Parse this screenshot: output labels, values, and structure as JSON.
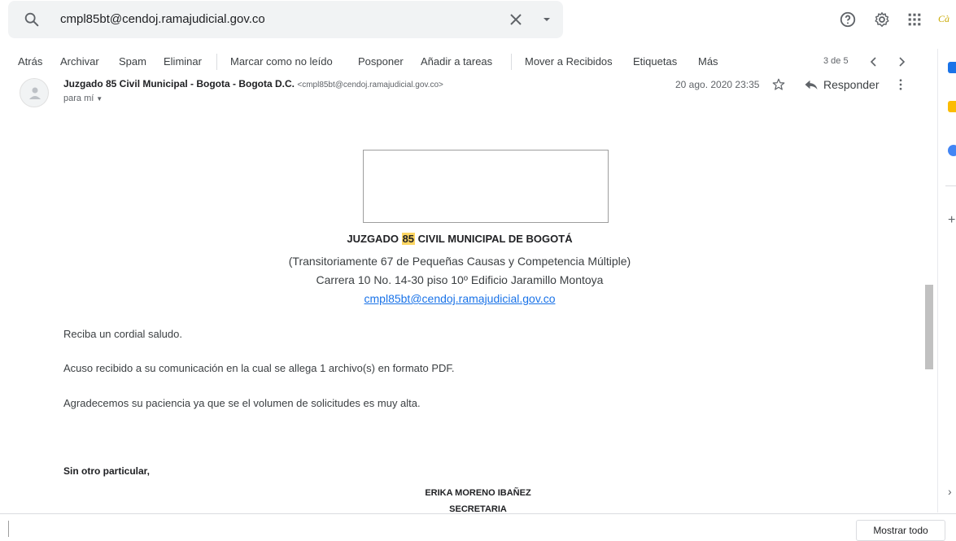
{
  "search": {
    "query": "cmpl85bt@cendoj.ramajudicial.gov.co"
  },
  "brand": {
    "text": "Cà"
  },
  "toolbar": {
    "back": "Atrás",
    "archive": "Archivar",
    "spam": "Spam",
    "delete": "Eliminar",
    "mark_unread": "Marcar como no leído",
    "snooze": "Posponer",
    "add_tasks": "Añadir a tareas",
    "move_inbox": "Mover a Recibidos",
    "labels": "Etiquetas",
    "more": "Más",
    "pager": "3 de 5"
  },
  "email": {
    "sender_name": "Juzgado 85 Civil Municipal - Bogota - Bogota D.C.",
    "sender_addr": "<cmpl85bt@cendoj.ramajudicial.gov.co>",
    "to": "para mí",
    "date": "20 ago. 2020 23:35",
    "reply": "Responder"
  },
  "body": {
    "court_prefix": "JUZGADO ",
    "court_highlight": "85",
    "court_suffix": " CIVIL MUNICIPAL DE BOGOTÁ",
    "line1": "(Transitoriamente 67 de Pequeñas Causas y Competencia Múltiple)",
    "line2": "Carrera 10 No. 14-30 piso 10º Edificio Jaramillo Montoya",
    "email_link": "cmpl85bt@cendoj.ramajudicial.gov.co",
    "greeting": "Reciba un cordial saludo.",
    "ack": "Acuso recibido a su comunicación en la cual se allega 1 archivo(s) en formato PDF.",
    "thanks": "Agradecemos su paciencia ya que se el volumen de solicitudes es muy alta.",
    "closing": "Sin otro particular,",
    "signer": "ERIKA MORENO IBAÑEZ",
    "signer_role": "SECRETARIA"
  },
  "bottom": {
    "show_all": "Mostrar todo"
  },
  "colors": {
    "accent": "#1a73e8",
    "highlight": "#fdd663",
    "search_bg": "#f1f3f4"
  }
}
